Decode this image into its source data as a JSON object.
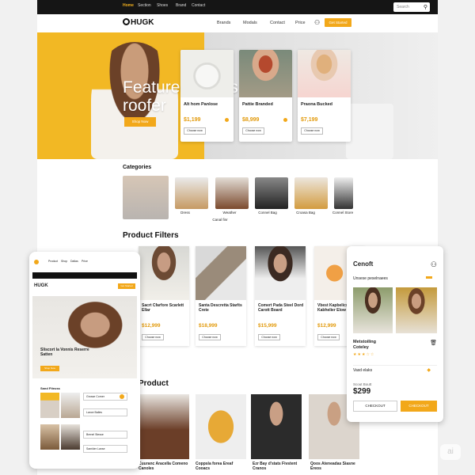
{
  "topbar": {
    "links": [
      "Home",
      "Section",
      "Shoes",
      "Brand",
      "Contact"
    ],
    "search_placeholder": "Search"
  },
  "site": {
    "logo": "HUGK",
    "nav": [
      "Brands",
      "Modals",
      "Contact",
      "Price"
    ],
    "cta": "Get Started"
  },
  "hero": {
    "title": "Featured Slices roofer",
    "button": "Shop Now",
    "cards": [
      {
        "name": "Alt hom Panlose",
        "price": "$1,199",
        "button": "Choose now"
      },
      {
        "name": "Pattie Branded",
        "price": "$8,999",
        "button": "Choose now"
      },
      {
        "name": "Praona Bucked",
        "price": "$7,199",
        "button": "Choose now"
      }
    ]
  },
  "categories": {
    "title": "Categories",
    "items": [
      "Dress",
      "Canal finr",
      "Weather",
      "Connel Bag",
      "Croasa Bag",
      "Connel Store"
    ]
  },
  "filters": {
    "title": "Product Filters",
    "cards": [
      {
        "name": "Sacrt Cfarfore Scarlett Ellar",
        "price": "$12,999",
        "button": "Choose now"
      },
      {
        "name": "Santa Descretta Starlts Crete",
        "price": "$18,999",
        "button": "Choose now"
      },
      {
        "name": "Comert Pada Steel Dord Carott Board",
        "price": "$15,999",
        "button": "Choose now"
      },
      {
        "name": "Vbest Kapbelics Kabhelier Elow",
        "price": "$12,999",
        "button": "Choose now"
      }
    ]
  },
  "products": {
    "title": "Product",
    "items": [
      "Cuuranc Aracella Comeno Canoles",
      "Coppsla forea Ereaf Cooacs",
      "Ezr Bay d'stats Fivstent Cranos",
      "Qoos Ateneadas Siasne Ereos"
    ]
  },
  "phone": {
    "nav": [
      "Product",
      "Shop",
      "Dallas",
      "Price"
    ],
    "logo": "HUGK",
    "cta": "Get Started",
    "hero_title": "Sliscort la Vonnis Reserre Satten",
    "hero_btn": "Shop Now",
    "section": "Sand Fiteuss",
    "fields": [
      "Grosse Corner",
      "Lance Balles",
      "Brenel Stesse",
      "Samlder Lanse"
    ]
  },
  "panel": {
    "title": "Cenoft",
    "subtitle": "Unsese peselnaees",
    "item_name": "Metstoiling Coteley",
    "shipping": "Vasd elaks",
    "sub_label": "Scout Boutt",
    "total": "$299",
    "checkout": "CHECKOUT",
    "continue": "CHECKOUT",
    "rating": 3
  },
  "watermark": "ai",
  "colors": {
    "accent": "#f2a81a",
    "hero_yellow": "#f2b824",
    "price": "#e29a0c"
  }
}
